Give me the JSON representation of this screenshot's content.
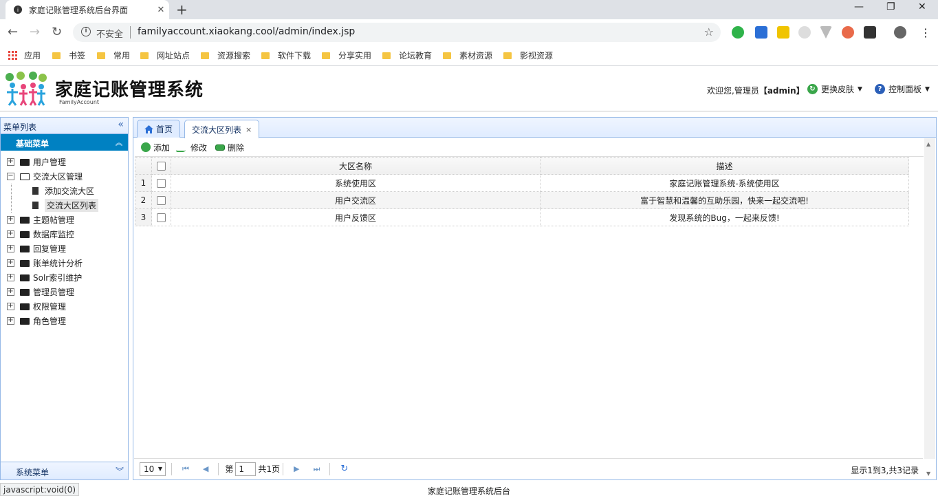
{
  "browser": {
    "tab_title": "家庭记账管理系统后台界面",
    "insecure_label": "不安全",
    "url": "familyaccount.xiaokang.cool/admin/index.jsp",
    "status_text": "javascript:void(0)"
  },
  "bookmarks": [
    "应用",
    "书签",
    "常用",
    "网址站点",
    "资源搜索",
    "软件下载",
    "分享实用",
    "论坛教育",
    "素材资源",
    "影视资源"
  ],
  "header": {
    "logo_title": "家庭记账管理系统",
    "logo_sub": "FamilyAccount",
    "welcome_prefix": "欢迎您,管理员",
    "welcome_user": "【admin】",
    "skin_label": "更换皮肤",
    "panel_label": "控制面板"
  },
  "left": {
    "title": "菜单列表",
    "accordion_title": "基础菜单",
    "footer_title": "系统菜单",
    "tree": {
      "user": "用户管理",
      "area": "交流大区管理",
      "area_add": "添加交流大区",
      "area_list": "交流大区列表",
      "topic": "主题帖管理",
      "db": "数据库监控",
      "reply": "回复管理",
      "bill": "账单统计分析",
      "solr": "Solr索引维护",
      "admin": "管理员管理",
      "perm": "权限管理",
      "role": "角色管理"
    }
  },
  "tabs": {
    "home": "首页",
    "current": "交流大区列表"
  },
  "grid": {
    "toolbar": {
      "add": "添加",
      "edit": "修改",
      "delete": "删除"
    },
    "columns": {
      "name": "大区名称",
      "desc": "描述"
    },
    "rows": [
      {
        "num": "1",
        "name": "系统使用区",
        "desc": "家庭记账管理系统-系统使用区"
      },
      {
        "num": "2",
        "name": "用户交流区",
        "desc": "富于智慧和温馨的互助乐园，快来一起交流吧!"
      },
      {
        "num": "3",
        "name": "用户反馈区",
        "desc": "发现系统的Bug，一起来反馈!"
      }
    ]
  },
  "pager": {
    "page_size": "10",
    "page_prefix": "第",
    "page_value": "1",
    "page_total": "共1页",
    "info": "显示1到3,共3记录"
  },
  "footer": {
    "text": "家庭记账管理系统后台"
  },
  "colors": {
    "accent": "#0081c2",
    "border": "#95b8e7",
    "header_grad": "#e0ecff"
  }
}
